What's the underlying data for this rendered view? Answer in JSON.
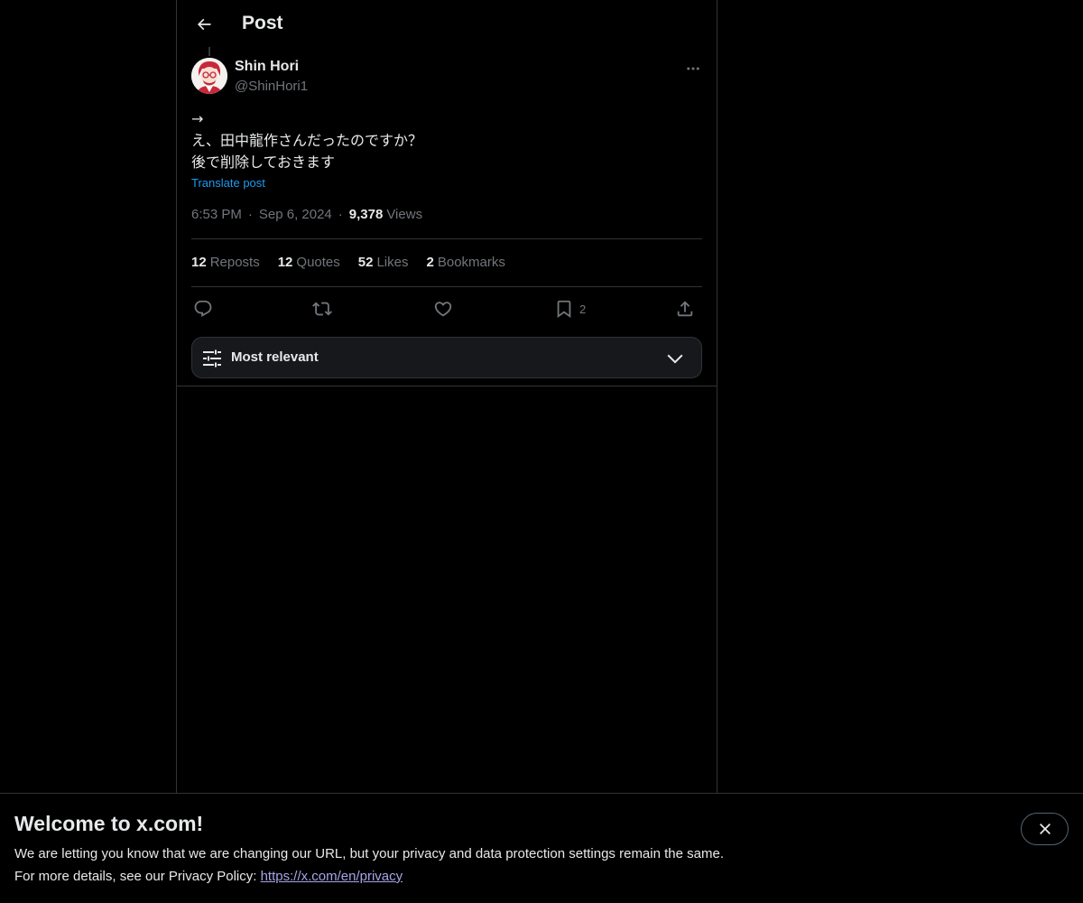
{
  "header": {
    "title": "Post"
  },
  "post": {
    "author_name": "Shin Hori",
    "author_handle": "@ShinHori1",
    "lines": [
      "→",
      "え、田中龍作さんだったのですか？",
      "後で削除しておきます"
    ],
    "translate_label": "Translate post",
    "time": "6:53 PM",
    "date": "Sep 6, 2024",
    "views_count": "9,378",
    "views_label": "Views"
  },
  "stats": {
    "reposts_count": "12",
    "reposts_label": "Reposts",
    "quotes_count": "12",
    "quotes_label": "Quotes",
    "likes_count": "52",
    "likes_label": "Likes",
    "bookmarks_count": "2",
    "bookmarks_label": "Bookmarks"
  },
  "actions": {
    "icons": [
      "reply-icon",
      "repost-icon",
      "like-icon",
      "bookmark-icon",
      "share-icon"
    ],
    "bookmark_count": "2"
  },
  "sort": {
    "label": "Most relevant"
  },
  "banner": {
    "title": "Welcome to x.com!",
    "line1": "We are letting you know that we are changing our URL, but your privacy and data protection settings remain the same.",
    "line2_prefix": "For more details, see our Privacy Policy: ",
    "link": "https://x.com/en/privacy"
  },
  "colors": {
    "background": "#000000",
    "text": "#e7e9ea",
    "muted": "#71767b",
    "accent": "#1d9bf0",
    "border": "#2f3336"
  }
}
